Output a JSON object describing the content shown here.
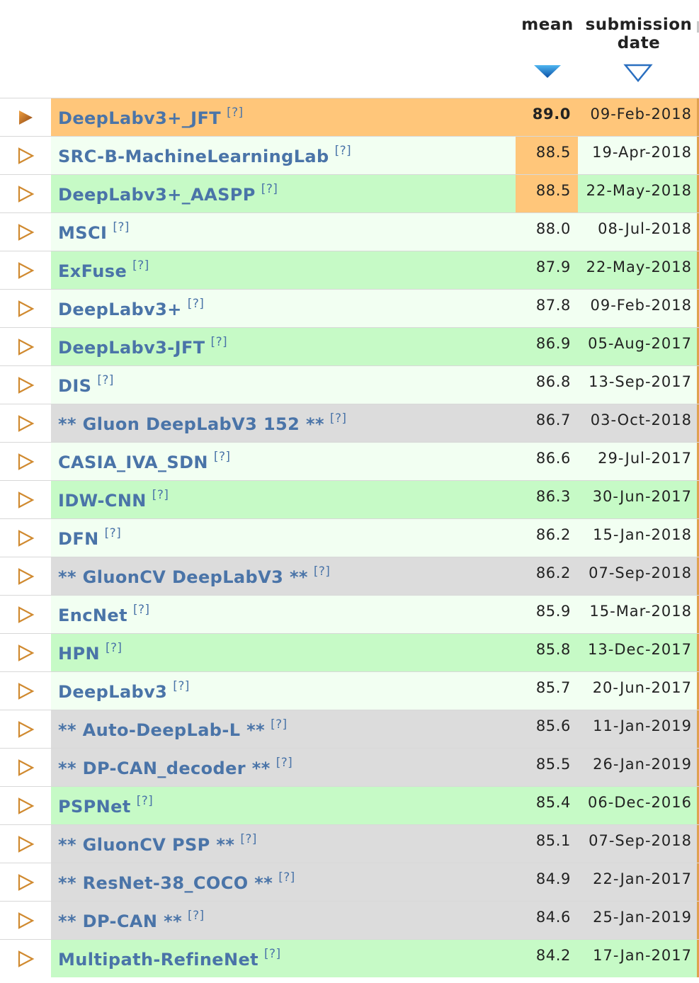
{
  "header": {
    "mean_label": "mean",
    "submission_label_line1": "submission",
    "submission_label_line2": "date",
    "mean_sort": "sort-desc-active-icon",
    "date_sort": "sort-desc-inactive-icon"
  },
  "colors": {
    "top_row": "#ffc67a",
    "published": "#c6fac6",
    "published_alt": "#f2fff2",
    "anonymous": "#dcdcdc",
    "link": "#4a74a8",
    "play_icon": "#d08a30"
  },
  "rows": [
    {
      "name": "DeepLabv3+_JFT",
      "q": "[?]",
      "mean": "89.0",
      "date": "09-Feb-2018"
    },
    {
      "name": "SRC-B-MachineLearningLab",
      "q": "[?]",
      "mean": "88.5",
      "date": "19-Apr-2018"
    },
    {
      "name": "DeepLabv3+_AASPP",
      "q": "[?]",
      "mean": "88.5",
      "date": "22-May-2018"
    },
    {
      "name": "MSCI",
      "q": "[?]",
      "mean": "88.0",
      "date": "08-Jul-2018"
    },
    {
      "name": "ExFuse",
      "q": "[?]",
      "mean": "87.9",
      "date": "22-May-2018"
    },
    {
      "name": "DeepLabv3+",
      "q": "[?]",
      "mean": "87.8",
      "date": "09-Feb-2018"
    },
    {
      "name": "DeepLabv3-JFT",
      "q": "[?]",
      "mean": "86.9",
      "date": "05-Aug-2017"
    },
    {
      "name": "DIS",
      "q": "[?]",
      "mean": "86.8",
      "date": "13-Sep-2017"
    },
    {
      "name": "** Gluon DeepLabV3 152 **",
      "q": "[?]",
      "mean": "86.7",
      "date": "03-Oct-2018"
    },
    {
      "name": "CASIA_IVA_SDN",
      "q": "[?]",
      "mean": "86.6",
      "date": "29-Jul-2017"
    },
    {
      "name": "IDW-CNN",
      "q": "[?]",
      "mean": "86.3",
      "date": "30-Jun-2017"
    },
    {
      "name": "DFN",
      "q": "[?]",
      "mean": "86.2",
      "date": "15-Jan-2018"
    },
    {
      "name": "** GluonCV DeepLabV3 **",
      "q": "[?]",
      "mean": "86.2",
      "date": "07-Sep-2018"
    },
    {
      "name": "EncNet",
      "q": "[?]",
      "mean": "85.9",
      "date": "15-Mar-2018"
    },
    {
      "name": "HPN",
      "q": "[?]",
      "mean": "85.8",
      "date": "13-Dec-2017"
    },
    {
      "name": "DeepLabv3",
      "q": "[?]",
      "mean": "85.7",
      "date": "20-Jun-2017"
    },
    {
      "name": "** Auto-DeepLab-L **",
      "q": "[?]",
      "mean": "85.6",
      "date": "11-Jan-2019"
    },
    {
      "name": "** DP-CAN_decoder **",
      "q": "[?]",
      "mean": "85.5",
      "date": "26-Jan-2019"
    },
    {
      "name": "PSPNet",
      "q": "[?]",
      "mean": "85.4",
      "date": "06-Dec-2016"
    },
    {
      "name": "** GluonCV PSP **",
      "q": "[?]",
      "mean": "85.1",
      "date": "07-Sep-2018"
    },
    {
      "name": "** ResNet-38_COCO **",
      "q": "[?]",
      "mean": "84.9",
      "date": "22-Jan-2017"
    },
    {
      "name": "** DP-CAN **",
      "q": "[?]",
      "mean": "84.6",
      "date": "25-Jan-2019"
    },
    {
      "name": "Multipath-RefineNet",
      "q": "[?]",
      "mean": "84.2",
      "date": "17-Jan-2017"
    }
  ]
}
